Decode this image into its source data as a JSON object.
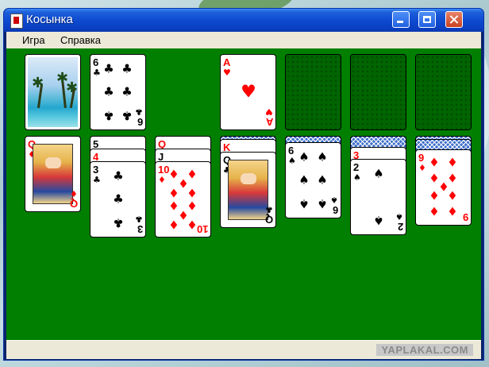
{
  "window": {
    "title": "Косынка"
  },
  "menu": {
    "items": [
      "Игра",
      "Справка"
    ]
  },
  "watermark": "YAPLAKAL.COM",
  "colors": {
    "felt": "#007f00",
    "titlebar": "#0e4bd2",
    "red_suit": "#ff0000"
  },
  "game": {
    "stock": {
      "card_back": "beach-palms"
    },
    "waste": {
      "rank": "6",
      "suit": "♣"
    },
    "foundations": [
      {
        "rank": "A",
        "suit": "♥"
      },
      {
        "rank": "",
        "suit": ""
      },
      {
        "rank": "",
        "suit": ""
      },
      {
        "rank": "",
        "suit": ""
      }
    ],
    "tableau": [
      {
        "stack": [
          {
            "rank": "Q",
            "suit": "♦"
          }
        ]
      },
      {
        "stack": [
          {
            "rank": "5",
            "suit": "♣"
          },
          {
            "rank": "4",
            "suit": "♦"
          },
          {
            "rank": "3",
            "suit": "♣"
          }
        ]
      },
      {
        "stack": [
          {
            "rank": "Q",
            "suit": "♦"
          },
          {
            "rank": "J",
            "suit": "♠"
          },
          {
            "rank": "10",
            "suit": "♦"
          }
        ]
      },
      {
        "hidden": 1,
        "stack": [
          {
            "rank": "K",
            "suit": "♦"
          },
          {
            "rank": "Q",
            "suit": "♣"
          }
        ]
      },
      {
        "hidden": 1,
        "stack": [
          {
            "rank": "6",
            "suit": "♠"
          }
        ]
      },
      {
        "hidden": 1,
        "stack": [
          {
            "rank": "3",
            "suit": "♦"
          },
          {
            "rank": "2",
            "suit": "♠"
          }
        ]
      },
      {
        "hidden": 2,
        "stack": [
          {
            "rank": "9",
            "suit": "♦"
          }
        ]
      }
    ]
  }
}
